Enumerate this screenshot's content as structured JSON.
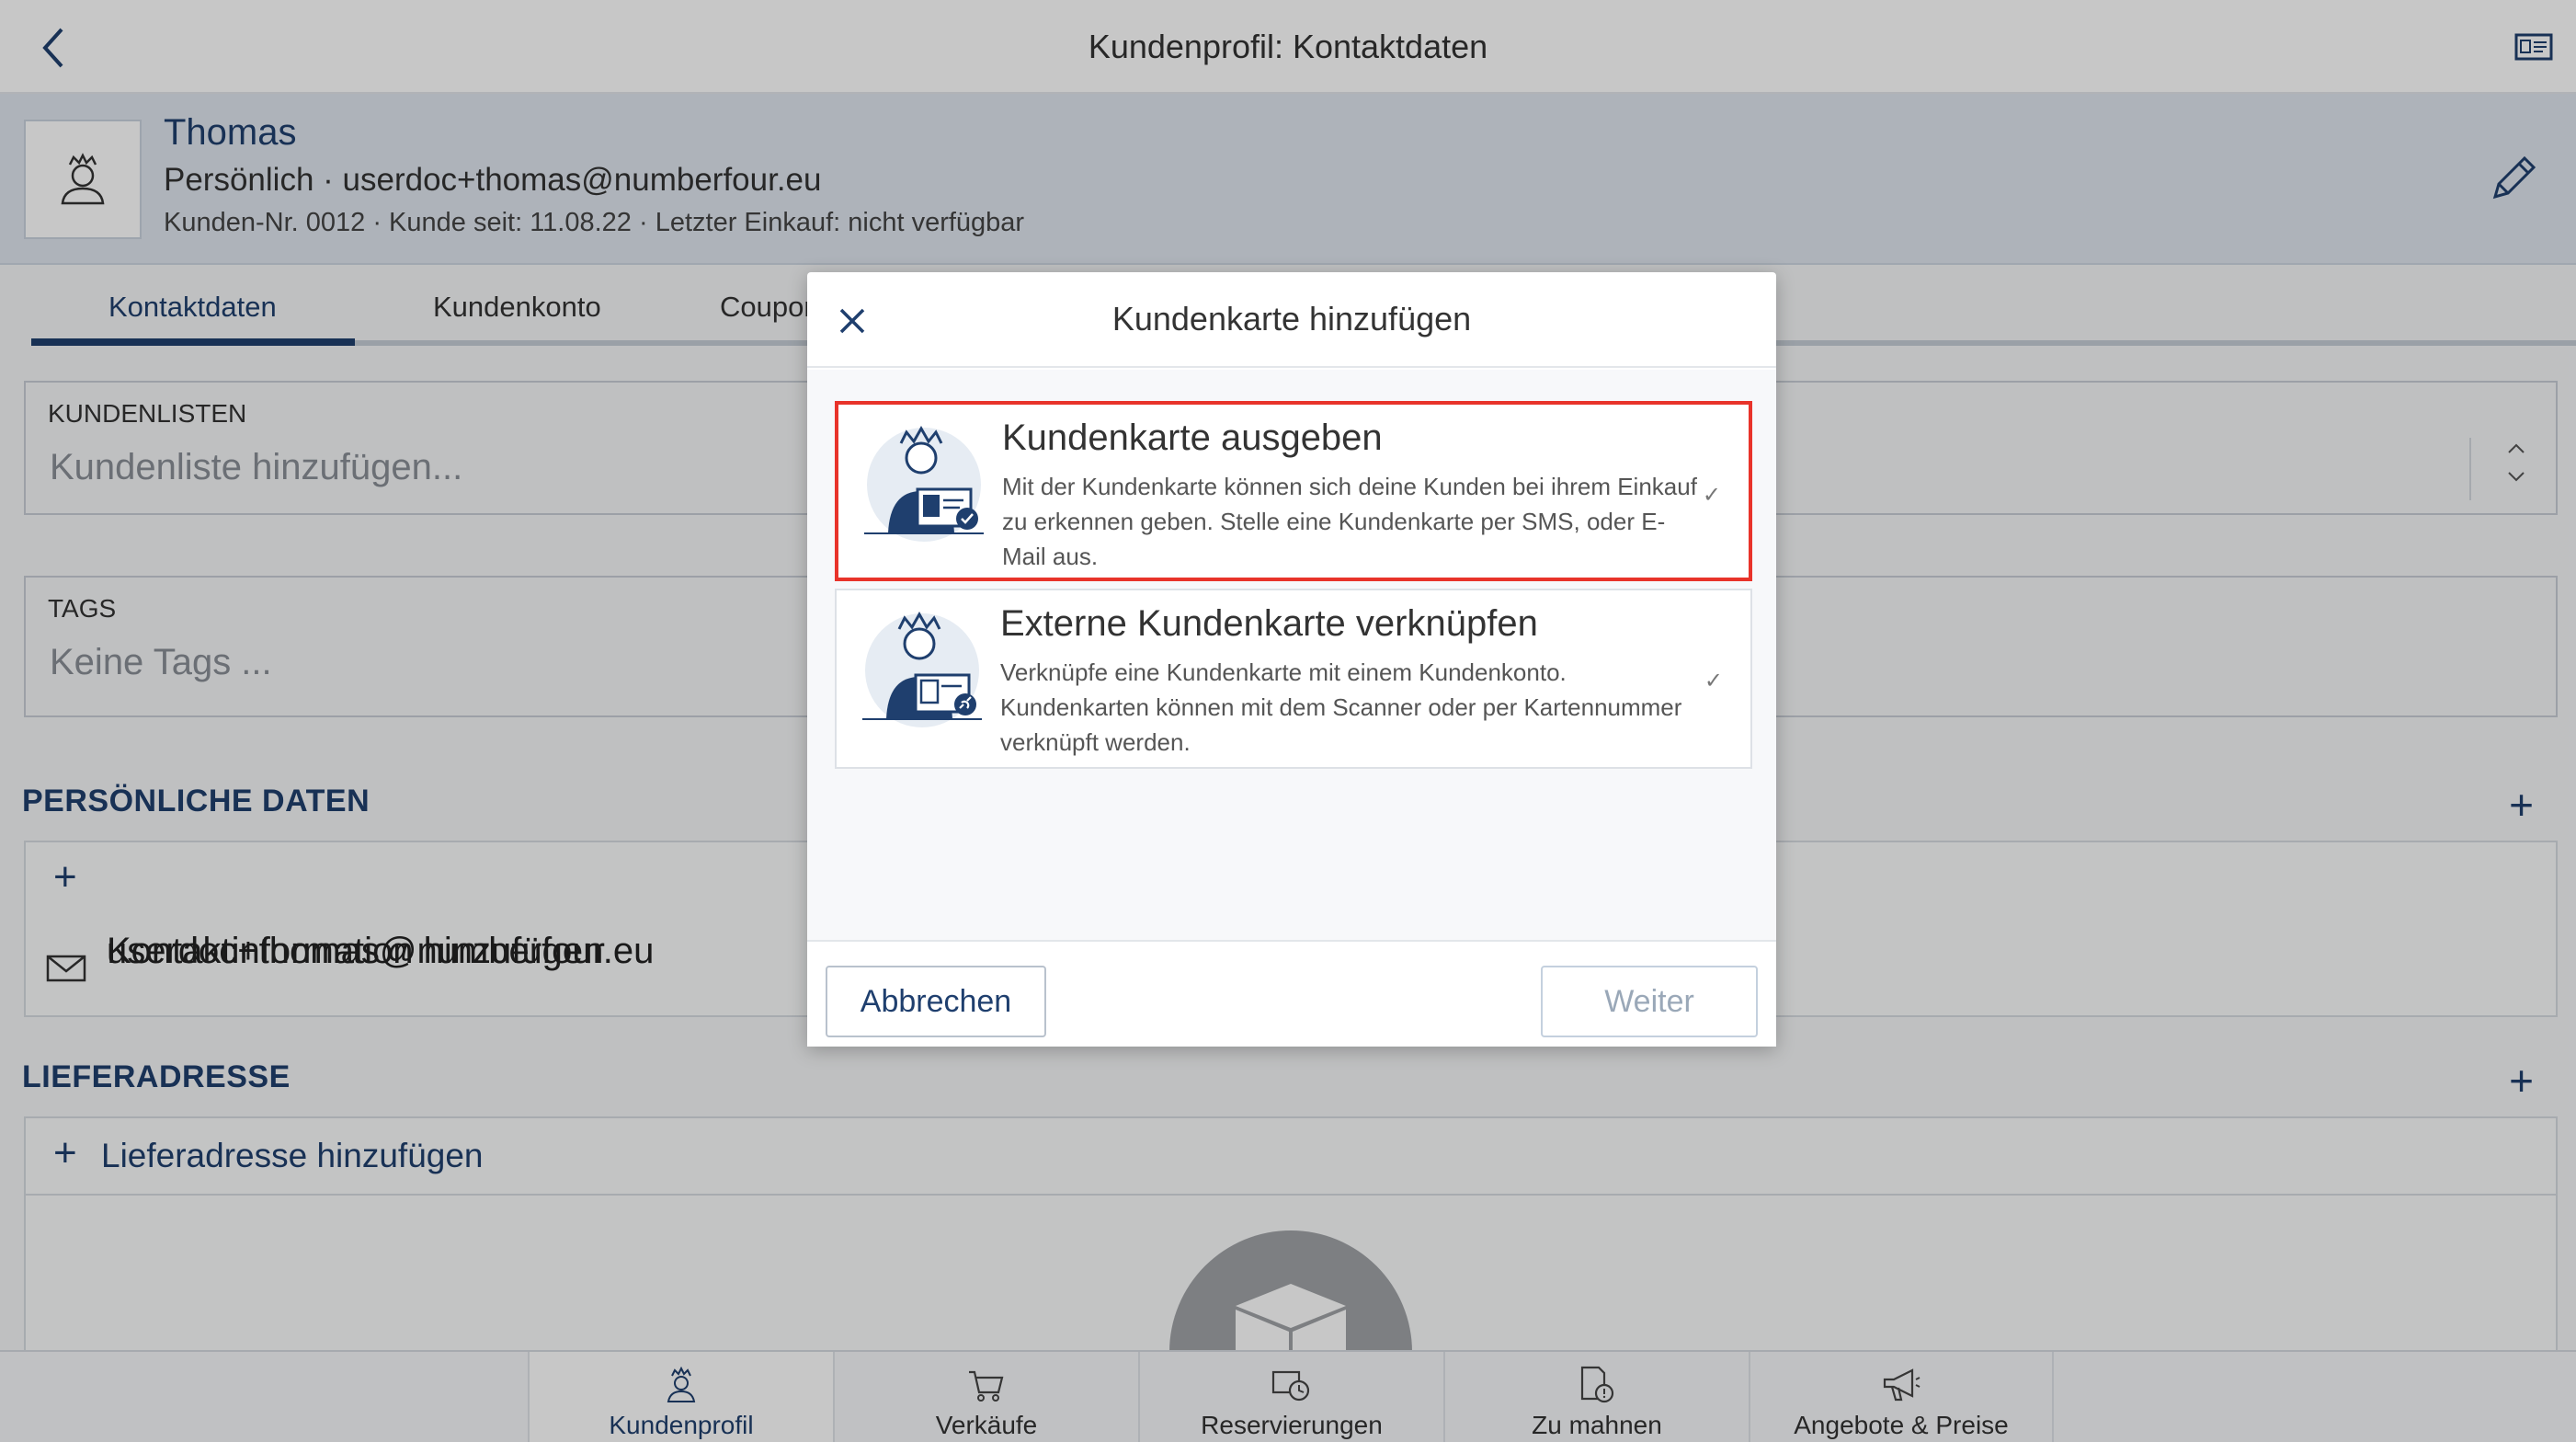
{
  "topbar": {
    "title": "Kundenprofil: Kontaktdaten",
    "back_icon": "chevron-left-icon",
    "card_icon": "id-card-icon"
  },
  "profile": {
    "name": "Thomas",
    "line1": "Persönlich · userdoc+thomas@numberfour.eu",
    "line2": "Kunden-Nr. 0012 · Kunde seit: 11.08.22 · Letzter Einkauf: nicht verfügbar",
    "edit_icon": "pencil-icon"
  },
  "tabs": [
    {
      "label": "Kontaktdaten",
      "active": true
    },
    {
      "label": "Kundenkonto",
      "active": false
    },
    {
      "label": "Coupons",
      "active": false
    }
  ],
  "fields": {
    "kundenlisten": {
      "label": "KUNDENLISTEN",
      "placeholder": "Kundenliste hinzufügen..."
    },
    "tags": {
      "label": "TAGS",
      "placeholder": "Keine Tags ..."
    }
  },
  "sections": {
    "personal": {
      "title": "PERSÖNLICHE DATEN",
      "add_contact": "Kontaktinformation hinzufügen",
      "email": "userdoc+thomas@numberfour.eu"
    },
    "delivery": {
      "title": "LIEFERADRESSE",
      "add_address": "Lieferadresse hinzufügen"
    }
  },
  "bottom_nav": [
    {
      "label": "Kundenprofil",
      "icon": "customer-icon",
      "active": true
    },
    {
      "label": "Verkäufe",
      "icon": "cart-icon",
      "active": false
    },
    {
      "label": "Reservierungen",
      "icon": "reservation-clock-icon",
      "active": false
    },
    {
      "label": "Zu mahnen",
      "icon": "payment-reminder-icon",
      "active": false
    },
    {
      "label": "Angebote & Preise",
      "icon": "megaphone-icon",
      "active": false
    }
  ],
  "dialog": {
    "title": "Kundenkarte hinzufügen",
    "options": [
      {
        "title": "Kundenkarte ausgeben",
        "description": "Mit der Kundenkarte können sich deine Kunden bei ihrem Einkauf zu erkennen geben. Stelle eine Kundenkarte per SMS, oder E-Mail aus.",
        "selected": true
      },
      {
        "title": "Externe Kundenkarte verknüpfen",
        "description": "Verknüpfe eine Kundenkarte mit einem Kundenkonto. Kundenkarten können mit dem Scanner oder per Kartennummer verknüpft werden.",
        "selected": false
      }
    ],
    "cancel_label": "Abbrechen",
    "next_label": "Weiter",
    "colors": {
      "primary": "#1f3f6e",
      "highlight": "#e8332a",
      "disabled_text": "#9aa8b8"
    }
  }
}
